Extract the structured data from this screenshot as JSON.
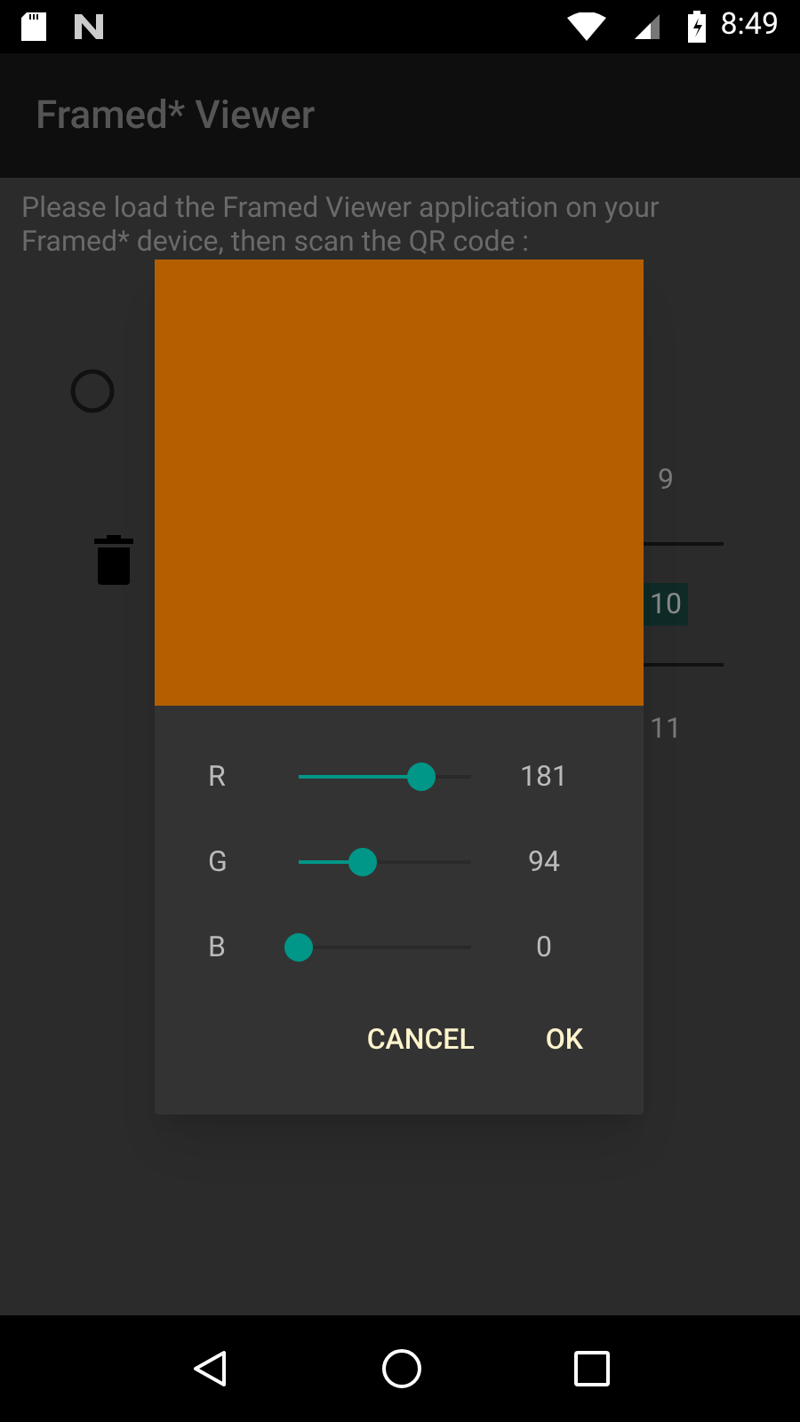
{
  "status_bar": {
    "time": "8:49"
  },
  "app_bar": {
    "title": "Framed* Viewer"
  },
  "content": {
    "instructions": "Please load the Framed Viewer application on your Framed* device, then scan the QR code :",
    "picker": [
      {
        "label": "9",
        "selected": false
      },
      {
        "label": "10",
        "selected": true
      },
      {
        "label": "11",
        "selected": false
      }
    ]
  },
  "dialog": {
    "channels": [
      {
        "label": "R",
        "level": 0.7098,
        "reading": "181"
      },
      {
        "label": "G",
        "level": 0.3686,
        "reading": "94"
      },
      {
        "label": "B",
        "level": 0,
        "reading": "0"
      }
    ],
    "buttons": [
      "CANCEL",
      "OK"
    ]
  }
}
